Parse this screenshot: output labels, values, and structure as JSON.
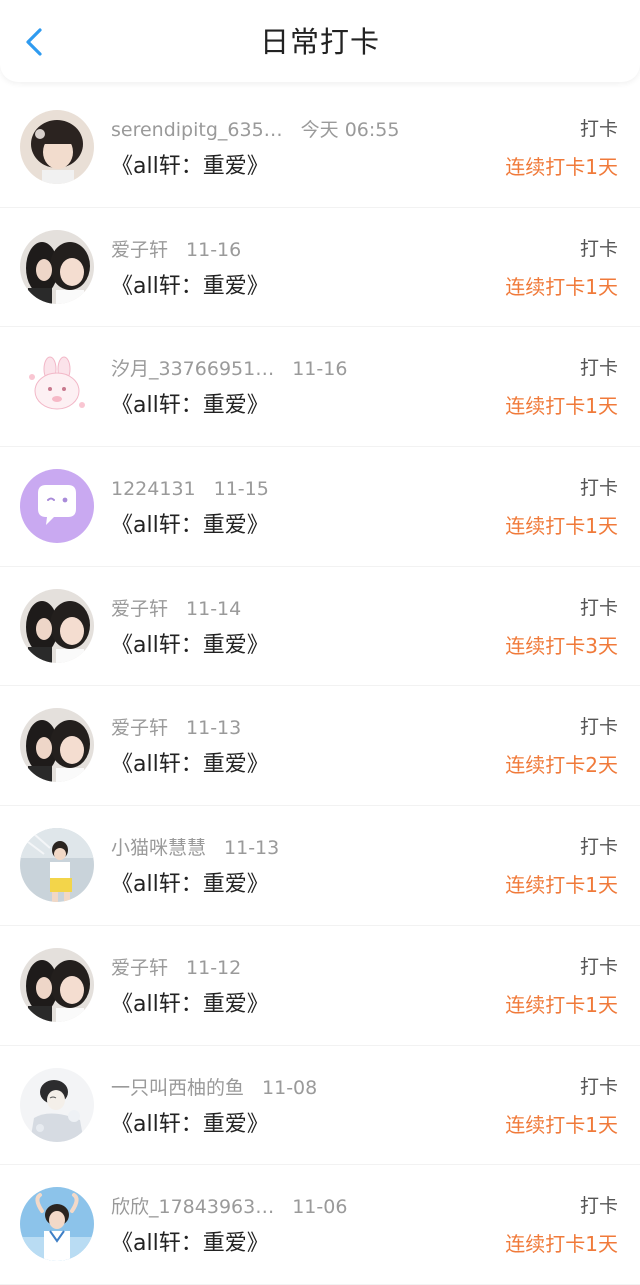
{
  "header": {
    "title": "日常打卡",
    "back_icon": "chevron-left-icon",
    "accent_color": "#2f9bf0"
  },
  "colors": {
    "streak": "#f07a3a",
    "muted": "#9a9a9a",
    "text": "#222222"
  },
  "entries": [
    {
      "username": "serendipitg_635…",
      "time": "今天 06:55",
      "book": "《all轩：重爱》",
      "action": "打卡",
      "streak": "连续打卡1天",
      "avatar": "girl-photo-avatar"
    },
    {
      "username": "爱子轩",
      "time": "11-16",
      "book": "《all轩：重爱》",
      "action": "打卡",
      "streak": "连续打卡1天",
      "avatar": "two-people-photo-avatar"
    },
    {
      "username": "汐月_33766951…",
      "time": "11-16",
      "book": "《all轩：重爱》",
      "action": "打卡",
      "streak": "连续打卡1天",
      "avatar": "bunny-sticker-avatar"
    },
    {
      "username": "1224131",
      "time": "11-15",
      "book": "《all轩：重爱》",
      "action": "打卡",
      "streak": "连续打卡1天",
      "avatar": "chat-bubble-avatar"
    },
    {
      "username": "爱子轩",
      "time": "11-14",
      "book": "《all轩：重爱》",
      "action": "打卡",
      "streak": "连续打卡3天",
      "avatar": "two-people-photo-avatar"
    },
    {
      "username": "爱子轩",
      "time": "11-13",
      "book": "《all轩：重爱》",
      "action": "打卡",
      "streak": "连续打卡2天",
      "avatar": "two-people-photo-avatar"
    },
    {
      "username": "小猫咪慧慧",
      "time": "11-13",
      "book": "《all轩：重爱》",
      "action": "打卡",
      "streak": "连续打卡1天",
      "avatar": "dancer-photo-avatar"
    },
    {
      "username": "爱子轩",
      "time": "11-12",
      "book": "《all轩：重爱》",
      "action": "打卡",
      "streak": "连续打卡1天",
      "avatar": "two-people-photo-avatar"
    },
    {
      "username": "一只叫西柚的鱼",
      "time": "11-08",
      "book": "《all轩：重爱》",
      "action": "打卡",
      "streak": "连续打卡1天",
      "avatar": "sketch-photo-avatar"
    },
    {
      "username": "欣欣_17843963…",
      "time": "11-06",
      "book": "《all轩：重爱》",
      "action": "打卡",
      "streak": "连续打卡1天",
      "avatar": "sky-photo-avatar"
    }
  ]
}
